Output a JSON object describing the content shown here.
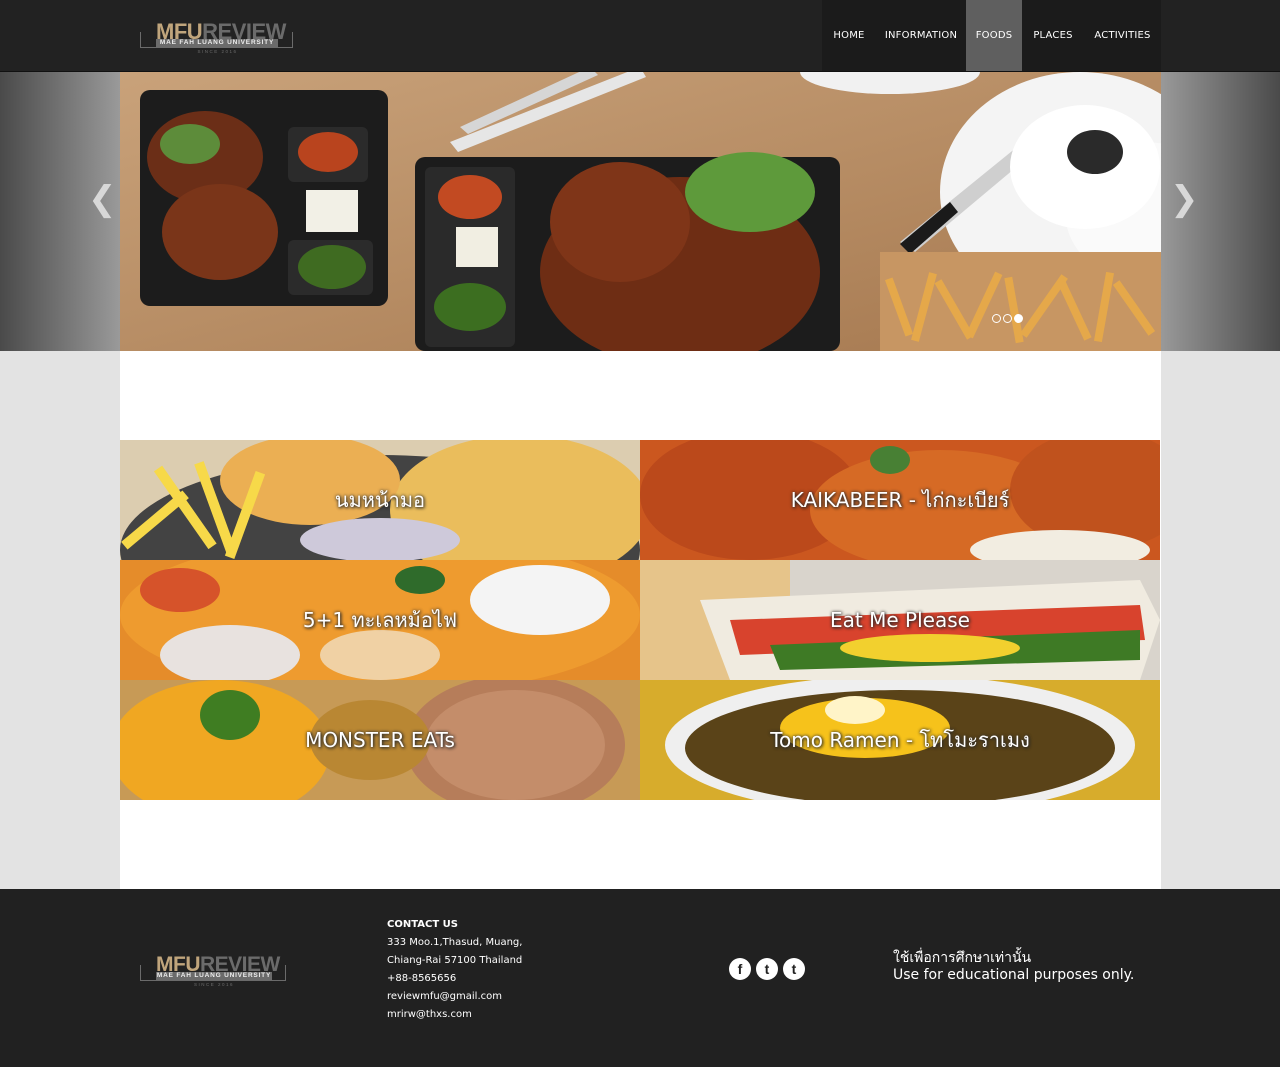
{
  "header": {
    "logo": {
      "main_a": "MFU",
      "main_b": "REVIEW",
      "subtitle": "MAE FAH LUANG UNIVERSITY",
      "since": "SINCE 2016"
    },
    "nav": [
      {
        "label": "HOME",
        "active": false
      },
      {
        "label": "INFORMATION",
        "active": false
      },
      {
        "label": "FOODS",
        "active": true
      },
      {
        "label": "PLACES",
        "active": false
      },
      {
        "label": "ACTIVITIES",
        "active": false
      }
    ]
  },
  "slider": {
    "prev_icon": "chevron-left-icon",
    "next_icon": "chevron-right-icon",
    "slide_count": 3,
    "active_slide": 3,
    "image": "food-table-photo"
  },
  "tiles": [
    {
      "label": "นมหน้ามอ",
      "image": "noodles-fries-photo"
    },
    {
      "label": "KAIKABEER - ไก่กะเบียร์",
      "image": "fried-chicken-photo"
    },
    {
      "label": "5+1 ทะเลหม้อไฟ",
      "image": "tom-yum-hotpot-photo"
    },
    {
      "label": "Eat Me Please",
      "image": "sandwich-photo"
    },
    {
      "label": "MONSTER EATs",
      "image": "fried-rice-photo"
    },
    {
      "label": "Tomo Ramen - โทโมะราเมง",
      "image": "curry-omelette-photo"
    }
  ],
  "footer": {
    "logo": {
      "main_a": "MFU",
      "main_b": "REVIEW",
      "subtitle": "MAE FAH LUANG UNIVERSITY",
      "since": "SINCE 2016"
    },
    "contact": {
      "heading": "CONTACT US",
      "address1": "333 Moo.1,Thasud, Muang,",
      "address2": "Chiang-Rai 57100 Thailand",
      "phone": "+88-8565656",
      "email1": "reviewmfu@gmail.com",
      "email2": "mrirw@thxs.com"
    },
    "social": [
      {
        "glyph": "f",
        "icon": "facebook-icon"
      },
      {
        "glyph": "t",
        "icon": "twitter-icon"
      },
      {
        "glyph": "t",
        "icon": "tumblr-icon"
      }
    ],
    "notice_th": "ใช้เพื่อการศึกษาเท่านั้น",
    "notice_en": "Use for educational purposes only."
  }
}
